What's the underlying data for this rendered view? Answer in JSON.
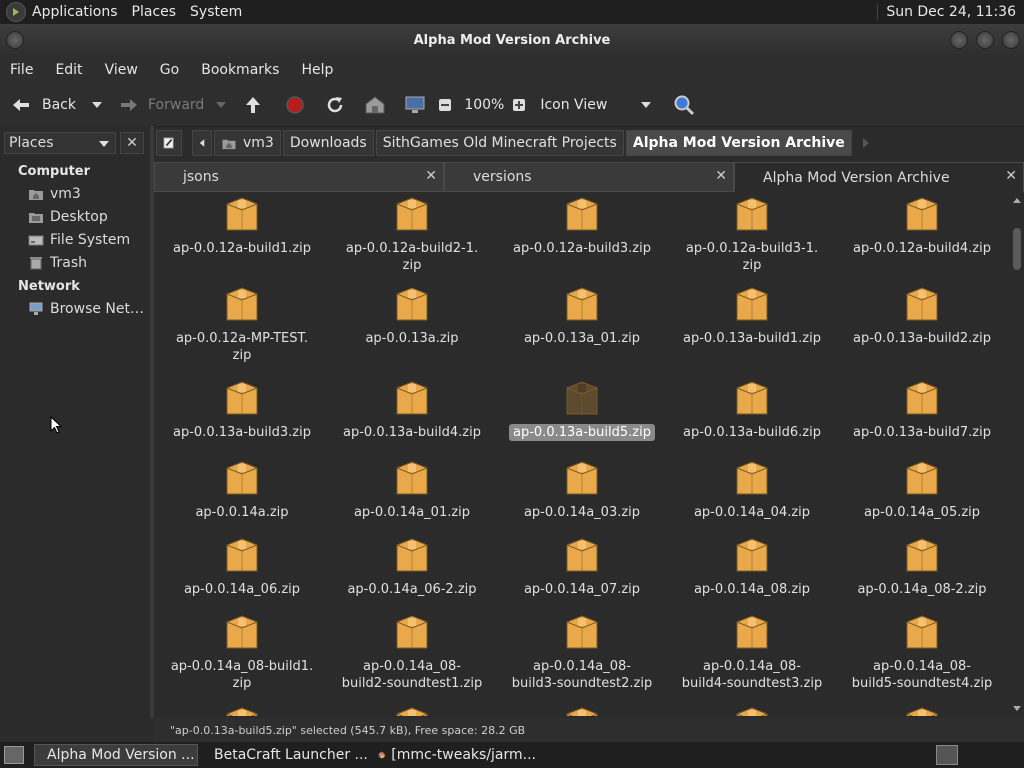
{
  "top_panel": {
    "menus": [
      "Applications",
      "Places",
      "System"
    ],
    "clock": "Sun Dec 24, 11:36"
  },
  "window": {
    "title": "Alpha Mod Version Archive"
  },
  "menubar": [
    "File",
    "Edit",
    "View",
    "Go",
    "Bookmarks",
    "Help"
  ],
  "toolbar": {
    "back_label": "Back",
    "forward_label": "Forward",
    "zoom": "100%",
    "view_mode": "Icon View"
  },
  "sidebar": {
    "header": "Places",
    "sections": [
      {
        "title": "Computer",
        "items": [
          {
            "label": "vm3",
            "icon": "home-folder-icon"
          },
          {
            "label": "Desktop",
            "icon": "desktop-icon"
          },
          {
            "label": "File System",
            "icon": "drive-icon"
          },
          {
            "label": "Trash",
            "icon": "trash-icon"
          }
        ]
      },
      {
        "title": "Network",
        "items": [
          {
            "label": "Browse Net…",
            "icon": "network-icon"
          }
        ]
      }
    ]
  },
  "breadcrumbs": [
    "vm3",
    "Downloads",
    "SithGames Old Minecraft Projects",
    "Alpha Mod Version Archive"
  ],
  "tabs": [
    {
      "label": "jsons",
      "active": false
    },
    {
      "label": "versions",
      "active": false
    },
    {
      "label": "Alpha Mod Version Archive",
      "active": true
    }
  ],
  "files": [
    {
      "name": "ap-0.0.12a-build1.zip"
    },
    {
      "name": "ap-0.0.12a-build2-1.\nzip"
    },
    {
      "name": "ap-0.0.12a-build3.zip"
    },
    {
      "name": "ap-0.0.12a-build3-1.\nzip"
    },
    {
      "name": "ap-0.0.12a-build4.zip"
    },
    {
      "name": "ap-0.0.12a-MP-TEST.\nzip"
    },
    {
      "name": "ap-0.0.13a.zip"
    },
    {
      "name": "ap-0.0.13a_01.zip"
    },
    {
      "name": "ap-0.0.13a-build1.zip"
    },
    {
      "name": "ap-0.0.13a-build2.zip"
    },
    {
      "name": "ap-0.0.13a-build3.zip"
    },
    {
      "name": "ap-0.0.13a-build4.zip"
    },
    {
      "name": "ap-0.0.13a-build5.zip",
      "selected": true
    },
    {
      "name": "ap-0.0.13a-build6.zip"
    },
    {
      "name": "ap-0.0.13a-build7.zip"
    },
    {
      "name": "ap-0.0.14a.zip"
    },
    {
      "name": "ap-0.0.14a_01.zip"
    },
    {
      "name": "ap-0.0.14a_03.zip"
    },
    {
      "name": "ap-0.0.14a_04.zip"
    },
    {
      "name": "ap-0.0.14a_05.zip"
    },
    {
      "name": "ap-0.0.14a_06.zip"
    },
    {
      "name": "ap-0.0.14a_06-2.zip"
    },
    {
      "name": "ap-0.0.14a_07.zip"
    },
    {
      "name": "ap-0.0.14a_08.zip"
    },
    {
      "name": "ap-0.0.14a_08-2.zip"
    },
    {
      "name": "ap-0.0.14a_08-build1.\nzip"
    },
    {
      "name": "ap-0.0.14a_08-\nbuild2-soundtest1.zip"
    },
    {
      "name": "ap-0.0.14a_08-\nbuild3-soundtest2.zip"
    },
    {
      "name": "ap-0.0.14a_08-\nbuild4-soundtest3.zip"
    },
    {
      "name": "ap-0.0.14a_08-\nbuild5-soundtest4.zip"
    },
    {
      "name": ""
    },
    {
      "name": ""
    },
    {
      "name": ""
    },
    {
      "name": ""
    },
    {
      "name": ""
    }
  ],
  "status": "\"ap-0.0.13a-build5.zip\" selected (545.7 kB), Free space: 28.2 GB",
  "taskbar": [
    {
      "label": "Alpha Mod Version ...",
      "icon": "folder-icon",
      "active": true
    },
    {
      "label": "BetaCraft Launcher ...",
      "icon": "java-app-icon",
      "active": false
    },
    {
      "label": "[mmc-tweaks/jarm...",
      "icon": "chrome-icon",
      "active": false
    }
  ],
  "colors": {
    "folder_icon": "#e9a94a",
    "selected_icon": "#5e4a2e",
    "selection_bg": "#8a8a8a"
  }
}
